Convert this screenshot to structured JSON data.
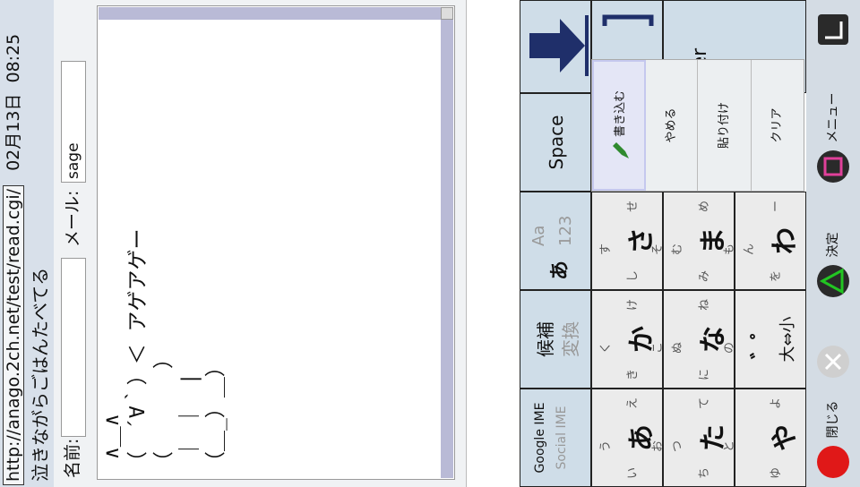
{
  "status": {
    "url": "http://anago.2ch.net/test/read.cgi/",
    "date": "02月13日",
    "time": "08:25"
  },
  "title": "泣きながらごはんたべてる",
  "form": {
    "name_label": "名前:",
    "name_value": "",
    "mail_label": "メール:",
    "mail_value": "sage",
    "body_lines": [
      " ∧＿∧",
      "（　´∀｀）＜ アゲアゲー",
      "（　　　　）",
      " ｜ ｜　|",
      "（＿_）＿）"
    ]
  },
  "ime": {
    "top_row": [
      "Google IME",
      "Social IME",
      "候補",
      "変換",
      "あ",
      "Aa",
      "123",
      "Space"
    ],
    "keys": [
      {
        "main": "あ",
        "subs": [
          "い",
          "う",
          "え",
          "お"
        ]
      },
      {
        "main": "か",
        "subs": [
          "き",
          "く",
          "け",
          "こ"
        ]
      },
      {
        "main": "さ",
        "subs": [
          "し",
          "す",
          "せ",
          "そ"
        ]
      },
      {
        "main": "た",
        "subs": [
          "ち",
          "つ",
          "て",
          "と"
        ]
      },
      {
        "main": "な",
        "subs": [
          "に",
          "ぬ",
          "ね",
          "の"
        ]
      },
      {
        "main": "ま",
        "subs": [
          "み",
          "む",
          "め",
          "も"
        ]
      },
      {
        "main": "や",
        "subs": [
          "ゆ",
          "",
          "よ",
          ""
        ]
      },
      {
        "main": "゛゜",
        "sub2": "大⇔小"
      },
      {
        "main": "わ",
        "subs": [
          "を",
          "ん",
          "ー",
          ""
        ]
      }
    ],
    "enter_partial": "nter",
    "popup": [
      "書き込む",
      "やめる",
      "貼り付け",
      "クリア"
    ]
  },
  "nav": {
    "close": "閉じる",
    "decide": "決定",
    "menu": "メニュー"
  },
  "colors": {
    "status_bg": "#d8e0ea",
    "func_key": "#cfdde8",
    "scroll": "#b9bad6"
  },
  "icons": [
    "pencil-icon",
    "down-arrow-icon",
    "circle-icon",
    "cross-icon",
    "triangle-icon",
    "square-icon",
    "corner-icon"
  ]
}
